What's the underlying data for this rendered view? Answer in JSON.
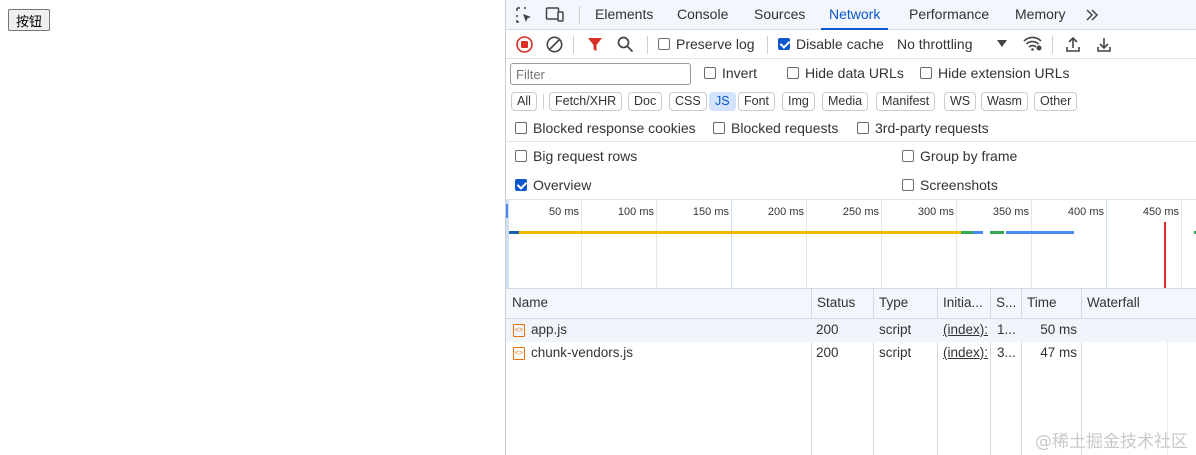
{
  "page": {
    "button_label": "按钮"
  },
  "devtools": {
    "tabs": [
      {
        "label": "Elements"
      },
      {
        "label": "Console"
      },
      {
        "label": "Sources"
      },
      {
        "label": "Network",
        "active": true
      },
      {
        "label": "Performance"
      },
      {
        "label": "Memory"
      }
    ],
    "toolbar": {
      "preserve_log": "Preserve log",
      "disable_cache": "Disable cache",
      "throttling": "No throttling"
    },
    "filter": {
      "placeholder": "Filter",
      "invert": "Invert",
      "hide_data_urls": "Hide data URLs",
      "hide_extension_urls": "Hide extension URLs"
    },
    "type_chips": [
      "All",
      "Fetch/XHR",
      "Doc",
      "CSS",
      "JS",
      "Font",
      "Img",
      "Media",
      "Manifest",
      "WS",
      "Wasm",
      "Other"
    ],
    "selected_chip": "JS",
    "blocked": {
      "blocked_response_cookies": "Blocked response cookies",
      "blocked_requests": "Blocked requests",
      "third_party_requests": "3rd-party requests"
    },
    "settings": {
      "big_request_rows": "Big request rows",
      "group_by_frame": "Group by frame",
      "overview": "Overview",
      "screenshots": "Screenshots"
    },
    "overview_ticks": [
      "50 ms",
      "100 ms",
      "150 ms",
      "200 ms",
      "250 ms",
      "300 ms",
      "350 ms",
      "400 ms",
      "450 ms"
    ],
    "columns": {
      "name": "Name",
      "status": "Status",
      "type": "Type",
      "initiator": "Initia...",
      "size": "S...",
      "time": "Time",
      "waterfall": "Waterfall"
    },
    "requests": [
      {
        "name": "app.js",
        "status": "200",
        "type": "script",
        "initiator": "(index):",
        "size": "1...",
        "time": "50 ms"
      },
      {
        "name": "chunk-vendors.js",
        "status": "200",
        "type": "script",
        "initiator": "(index):",
        "size": "3...",
        "time": "47 ms"
      }
    ]
  },
  "watermark": "@稀土掘金技术社区",
  "colors": {
    "accent": "#0b57d0",
    "record_red": "#d93025",
    "bar_yellow": "#f2b705",
    "bar_blue": "#4a8af4",
    "bar_green": "#34a853"
  }
}
